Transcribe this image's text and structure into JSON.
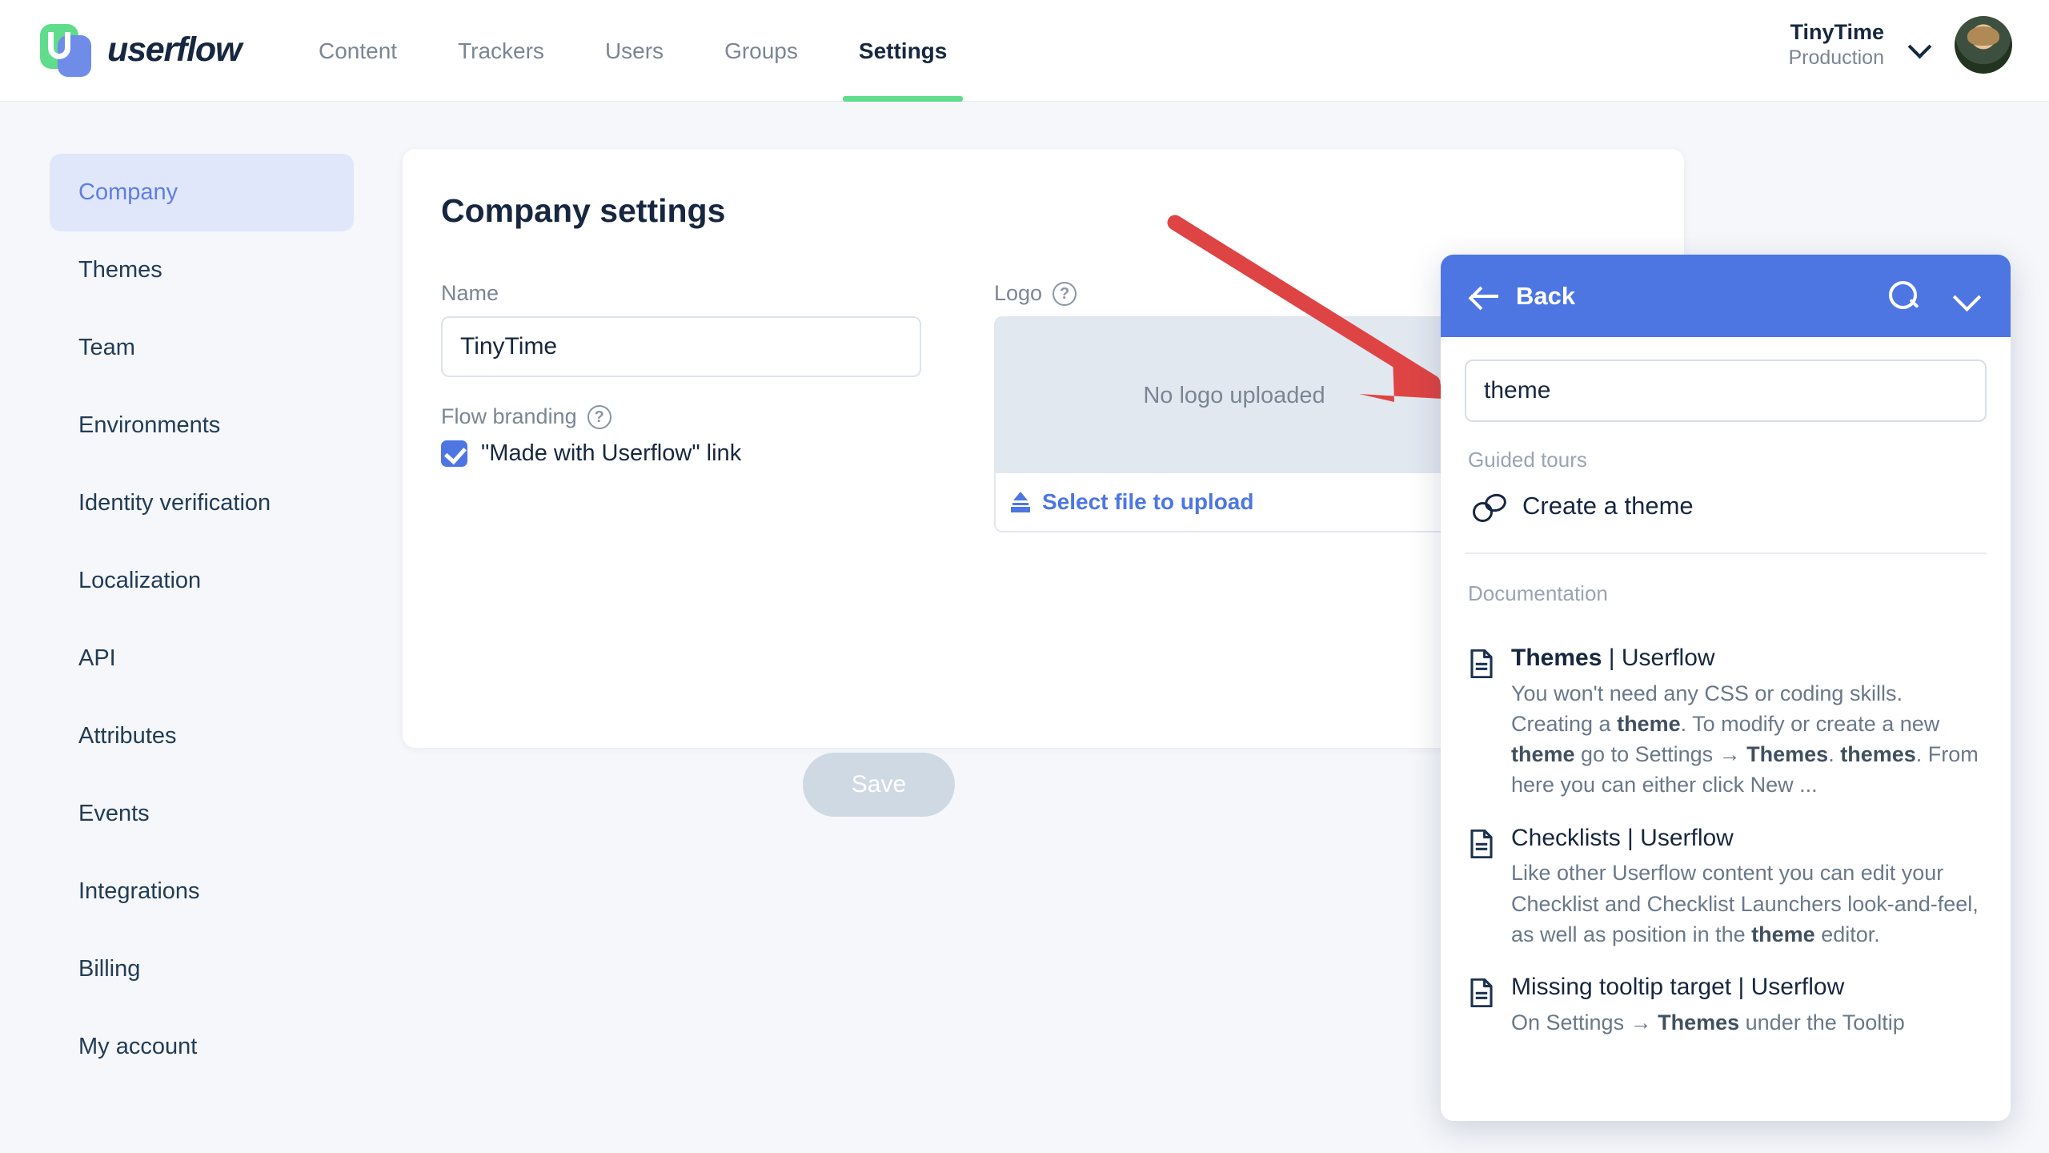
{
  "colors": {
    "accent_blue": "#4d76e3",
    "brand_green": "#5fdc8c",
    "arrow_red": "#de4444",
    "dark_text": "#17273f",
    "muted_text": "#7b8694",
    "sidebar_active_bg": "#e1e7fb"
  },
  "topnav": {
    "brand": "userflow",
    "brand_mark_icon": "userflow-logo-icon",
    "items": [
      {
        "label": "Content",
        "active": false
      },
      {
        "label": "Trackers",
        "active": false
      },
      {
        "label": "Users",
        "active": false
      },
      {
        "label": "Groups",
        "active": false
      },
      {
        "label": "Settings",
        "active": true
      }
    ],
    "account": {
      "name": "TinyTime",
      "environment": "Production",
      "caret_icon": "chevron-down-icon",
      "avatar_icon": "user-avatar"
    }
  },
  "sidebar": {
    "items": [
      {
        "label": "Company",
        "active": true
      },
      {
        "label": "Themes",
        "active": false
      },
      {
        "label": "Team",
        "active": false
      },
      {
        "label": "Environments",
        "active": false
      },
      {
        "label": "Identity verification",
        "active": false
      },
      {
        "label": "Localization",
        "active": false
      },
      {
        "label": "API",
        "active": false
      },
      {
        "label": "Attributes",
        "active": false
      },
      {
        "label": "Events",
        "active": false
      },
      {
        "label": "Integrations",
        "active": false
      },
      {
        "label": "Billing",
        "active": false
      },
      {
        "label": "My account",
        "active": false
      }
    ]
  },
  "main": {
    "title": "Company settings",
    "name_field": {
      "label": "Name",
      "value": "TinyTime",
      "placeholder": "Company name"
    },
    "flow_branding": {
      "label": "Flow branding",
      "help_icon": "question-mark-icon",
      "checkbox_label": "\"Made with Userflow\" link",
      "checked": true
    },
    "logo": {
      "label": "Logo",
      "help_icon": "question-mark-icon",
      "empty_text": "No logo uploaded",
      "upload_label": "Select file to upload",
      "upload_icon": "upload-icon"
    },
    "save_label": "Save"
  },
  "annotation": {
    "arrow_icon": "red-pointer-arrow",
    "color": "#de4444"
  },
  "resource_center": {
    "header": {
      "back_label": "Back",
      "back_icon": "arrow-left-icon",
      "search_icon": "search-icon",
      "collapse_icon": "chevron-down-icon"
    },
    "search": {
      "value": "theme",
      "placeholder": "Search"
    },
    "guided_tours": {
      "section_label": "Guided tours",
      "items": [
        {
          "label": "Create a theme",
          "icon": "guided-tour-icon"
        }
      ]
    },
    "documentation": {
      "section_label": "Documentation",
      "items": [
        {
          "icon": "document-icon",
          "title_bold": "Themes",
          "title_rest": " | Userflow",
          "description": "You won't need any CSS or coding skills. Creating a theme. To modify or create a new theme go to Settings → Themes. themes. From here you can either click New ..."
        },
        {
          "icon": "document-icon",
          "title_bold": "",
          "title_rest": "Checklists | Userflow",
          "description": "Like other Userflow content you can edit your Checklist and Checklist Launchers look-and-feel, as well as position in the theme editor."
        },
        {
          "icon": "document-icon",
          "title_bold": "",
          "title_rest": "Missing tooltip target | Userflow",
          "description": "On Settings → Themes under the Tooltip"
        }
      ]
    }
  }
}
